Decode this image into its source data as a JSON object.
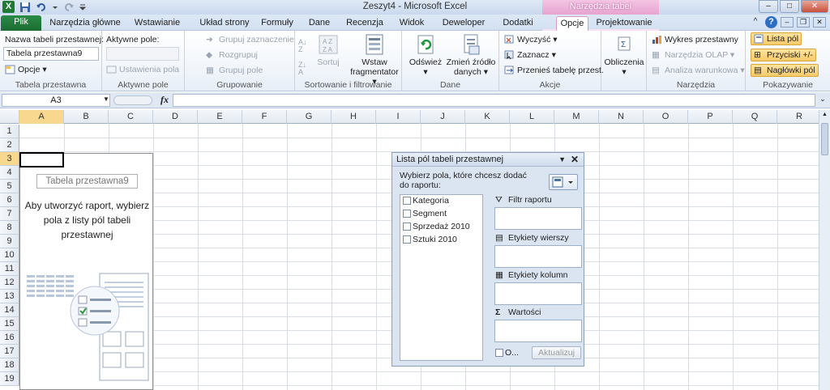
{
  "window": {
    "title": "Zeszyt4 - Microsoft Excel",
    "context_title": "Narzędzia tabel przestawnych",
    "controls": [
      "–",
      "□",
      "✕"
    ]
  },
  "tabs": {
    "file": "Plik",
    "items": [
      "Narzędzia główne",
      "Wstawianie",
      "Układ strony",
      "Formuły",
      "Dane",
      "Recenzja",
      "Widok",
      "Deweloper",
      "Dodatki",
      "Opcje",
      "Projektowanie"
    ],
    "active": "Opcje"
  },
  "ribbon": {
    "pivot_table": {
      "name_label": "Nazwa tabeli przestawnej:",
      "name_value": "Tabela przestawna9",
      "options": "Opcje",
      "group": "Tabela przestawna"
    },
    "active_field": {
      "label": "Aktywne pole:",
      "settings": "Ustawienia pola",
      "group": "Aktywne pole"
    },
    "grouping": {
      "items": [
        "Grupuj zaznaczenie",
        "Rozgrupuj",
        "Grupuj pole"
      ],
      "group": "Grupowanie"
    },
    "sort_filter": {
      "sort": "Sortuj",
      "insert_slicer": "Wstaw fragmentator",
      "group": "Sortowanie i filtrowanie"
    },
    "data": {
      "refresh": "Odśwież",
      "change_source": "Zmień źródło danych",
      "group": "Dane"
    },
    "actions": {
      "clear": "Wyczyść",
      "select": "Zaznacz",
      "move": "Przenieś tabelę przest.",
      "group": "Akcje"
    },
    "calculations": {
      "label": "Obliczenia"
    },
    "tools": {
      "chart": "Wykres przestawny",
      "olap": "Narzędzia OLAP",
      "whatif": "Analiza warunkowa",
      "group": "Narzędzia"
    },
    "show": {
      "field_list": "Lista pól",
      "buttons": "Przyciski +/-",
      "headers": "Nagłówki pól",
      "group": "Pokazywanie"
    }
  },
  "formula_bar": {
    "name_box": "A3",
    "fx": "fx",
    "value": ""
  },
  "sheet": {
    "columns": [
      "A",
      "B",
      "C",
      "D",
      "E",
      "F",
      "G",
      "H",
      "I",
      "J",
      "K",
      "L",
      "M",
      "N",
      "O",
      "P",
      "Q",
      "R"
    ],
    "rows": [
      "1",
      "2",
      "3",
      "4",
      "5",
      "6",
      "7",
      "8",
      "9",
      "10",
      "11",
      "12",
      "13",
      "14",
      "15",
      "16",
      "17",
      "18",
      "19"
    ],
    "selected_cell": "A3"
  },
  "pivot_placeholder": {
    "name": "Tabela przestawna9",
    "message": "Aby utworzyć raport, wybierz pola z listy pól tabeli przestawnej"
  },
  "field_list": {
    "title": "Lista pól tabeli przestawnej",
    "instruction": "Wybierz pola, które chcesz dodać do raportu:",
    "fields": [
      "Kategoria",
      "Segment",
      "Sprzedaż 2010",
      "Sztuki 2010"
    ],
    "areas": [
      "Filtr raportu",
      "Etykiety wierszy",
      "Etykiety kolumn",
      "Wartości"
    ],
    "defer_label": "O...",
    "update": "Aktualizuj"
  }
}
